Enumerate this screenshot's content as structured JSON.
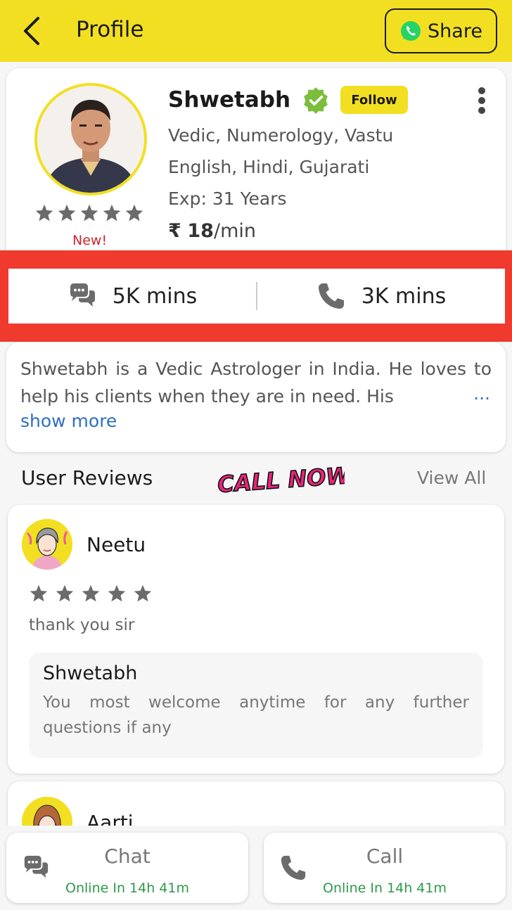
{
  "header": {
    "title": "Profile",
    "share_label": "Share"
  },
  "profile": {
    "name": "Shwetabh",
    "follow_label": "Follow",
    "skills": "Vedic, Numerology, Vastu",
    "languages": "English, Hindi, Gujarati",
    "experience": "Exp: 31 Years",
    "price_symbol": "₹",
    "price_value": "18",
    "price_unit": "/min",
    "rating_stars": 5,
    "new_label": "New!"
  },
  "stats": {
    "chat_mins": "5K mins",
    "call_mins": "3K mins"
  },
  "about": {
    "text": "Shwetabh is a Vedic Astrologer in India. He loves to help his clients when they are in need. His",
    "ellipsis": "...",
    "show_more": "show more"
  },
  "reviews": {
    "title": "User Reviews",
    "call_now_text": "CALL NOW!",
    "view_all": "View All",
    "items": [
      {
        "name": "Neetu",
        "stars": 5,
        "text": "thank you sir",
        "reply_name": "Shwetabh",
        "reply_text": "You most welcome anytime for any further questions if any"
      },
      {
        "name": "Aarti"
      }
    ]
  },
  "bottom": {
    "chat_label": "Chat",
    "chat_status": "Online In 14h 41m",
    "call_label": "Call",
    "call_status": "Online In 14h 41m"
  },
  "colors": {
    "brand_yellow": "#f2df22",
    "highlight_red": "#f03a2e",
    "online_green": "#2e9a4a",
    "link_blue": "#2e6fc4"
  }
}
